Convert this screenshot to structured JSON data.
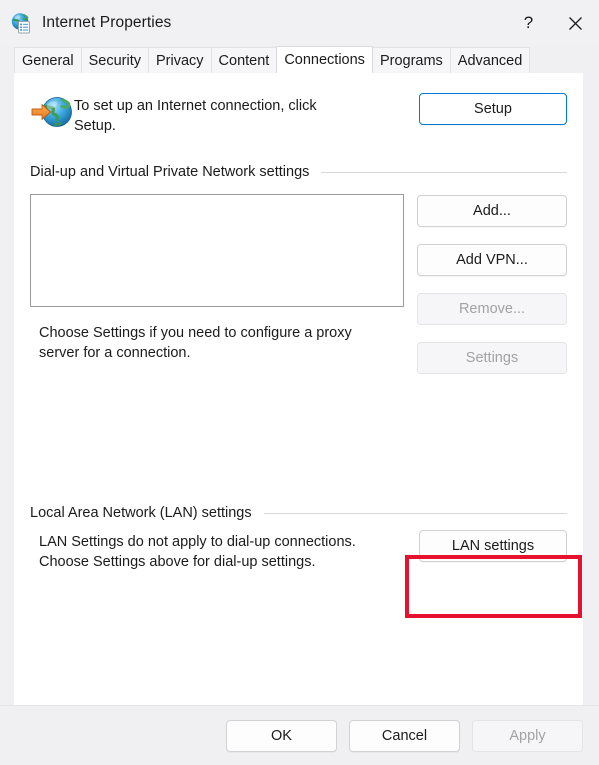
{
  "window": {
    "title": "Internet Properties",
    "icon": "internet-properties-globe-icon",
    "help_label": "?",
    "close_label": "✕"
  },
  "tabs": [
    {
      "label": "General",
      "active": false
    },
    {
      "label": "Security",
      "active": false
    },
    {
      "label": "Privacy",
      "active": false
    },
    {
      "label": "Content",
      "active": false
    },
    {
      "label": "Connections",
      "active": true
    },
    {
      "label": "Programs",
      "active": false
    },
    {
      "label": "Advanced",
      "active": false
    }
  ],
  "intro": {
    "icon": "globe-with-arrow-icon",
    "text": "To set up an Internet connection, click Setup.",
    "setup_label": "Setup"
  },
  "dialup": {
    "group_title": "Dial-up and Virtual Private Network settings",
    "list_items": [],
    "note": "Choose Settings if you need to configure a proxy server for a connection.",
    "buttons": [
      {
        "label": "Add...",
        "disabled": false
      },
      {
        "label": "Add VPN...",
        "disabled": false
      },
      {
        "label": "Remove...",
        "disabled": true
      },
      {
        "label": "Settings",
        "disabled": true
      }
    ]
  },
  "lan": {
    "group_title": "Local Area Network (LAN) settings",
    "note": "LAN Settings do not apply to dial-up connections. Choose Settings above for dial-up settings.",
    "button_label": "LAN settings"
  },
  "footer": {
    "ok_label": "OK",
    "cancel_label": "Cancel",
    "apply_label": "Apply",
    "apply_disabled": true
  },
  "annotation": {
    "color": "#e8112d",
    "target": "lan-settings-button"
  }
}
